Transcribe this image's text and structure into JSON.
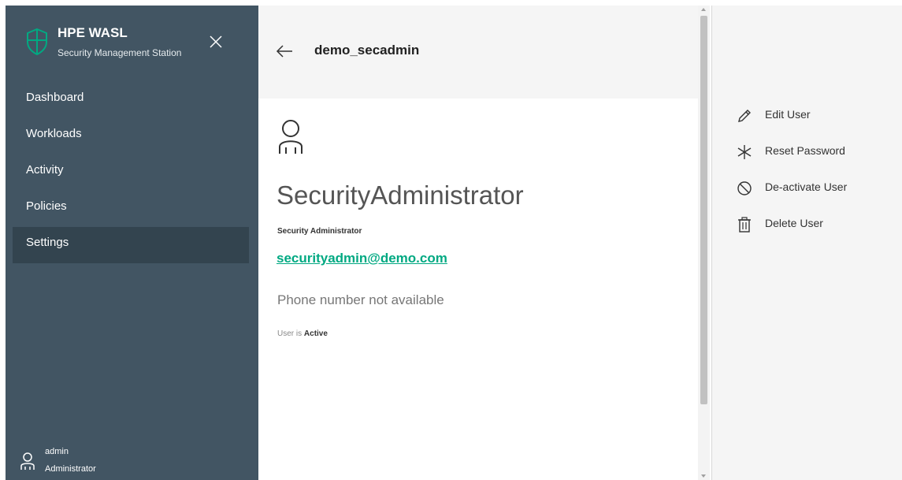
{
  "brand": {
    "title": "HPE WASL",
    "subtitle": "Security Management Station"
  },
  "nav": {
    "items": [
      {
        "label": "Dashboard"
      },
      {
        "label": "Workloads"
      },
      {
        "label": "Activity"
      },
      {
        "label": "Policies"
      },
      {
        "label": "Settings",
        "active": true
      }
    ]
  },
  "current_user": {
    "name": "admin",
    "role": "Administrator"
  },
  "header": {
    "title": "demo_secadmin"
  },
  "profile": {
    "display_name": "SecurityAdministrator",
    "role": "Security Administrator",
    "email": "securityadmin@demo.com",
    "phone": "Phone number not available",
    "status_prefix": "User is",
    "status_value": "Active"
  },
  "actions": {
    "edit": "Edit User",
    "reset": "Reset Password",
    "deactivate": "De-activate User",
    "delete": "Delete User"
  },
  "colors": {
    "sidebar_bg": "#425563",
    "sidebar_active": "#33444f",
    "accent_green": "#01a982",
    "panel_bg": "#f5f5f5"
  }
}
